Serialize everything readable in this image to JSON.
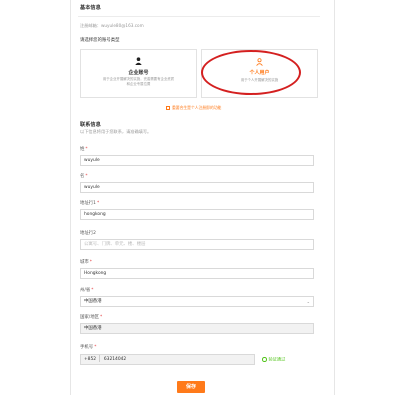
{
  "section_basic": {
    "title": "基本信息",
    "email_label": "注册邮箱：",
    "email_value": "wuyule80@163.com"
  },
  "account_type": {
    "prompt": "请选择您的账号类型",
    "enterprise": {
      "title": "企业账号",
      "desc_line1": "用于企业开展解决的实施，完善需要有企业资质",
      "desc_line2": "和企业专属位置"
    },
    "personal": {
      "title": "个人用户",
      "desc": "用于个人开展解决的实施"
    },
    "note": "重要合生是个人注册即的功能"
  },
  "section_contact": {
    "title": "联系信息",
    "subtitle": "以下信息将用于您联系，请准确填写。"
  },
  "fields": {
    "last_name": {
      "label": "姓",
      "value": "wuyule"
    },
    "first_name": {
      "label": "名",
      "value": "wuyule"
    },
    "address1": {
      "label": "地址行1",
      "value": "hongkong"
    },
    "address2": {
      "label": "地址行2",
      "placeholder": "公寓号、门牌、单元、楼、楼层"
    },
    "city": {
      "label": "城市",
      "value": "Hongkong"
    },
    "province": {
      "label": "州/省",
      "value": "中国香港"
    },
    "country": {
      "label": "国家/地区",
      "value": "中国香港"
    },
    "phone": {
      "label": "手机号",
      "prefix": "+852",
      "value": "63214042",
      "verify_text": "验证通过"
    }
  },
  "save_button": {
    "label": "保存"
  },
  "colors": {
    "accent": "#ff7a1a",
    "required": "#e4393c",
    "annotation": "#d42020",
    "verified": "#52c41a"
  }
}
